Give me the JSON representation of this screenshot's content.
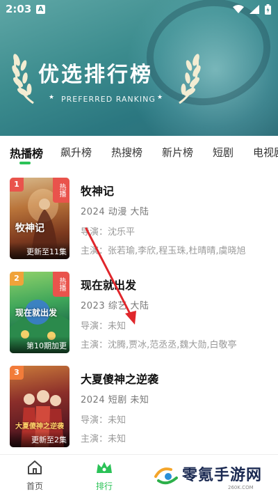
{
  "status": {
    "time": "2:03",
    "notif_icon": "A"
  },
  "banner": {
    "title": "优选排行榜",
    "subtitle": "PREFERRED RANKING"
  },
  "tabs": [
    {
      "label": "热播榜",
      "active": true
    },
    {
      "label": "飙升榜"
    },
    {
      "label": "热搜榜"
    },
    {
      "label": "新片榜"
    },
    {
      "label": "短剧"
    },
    {
      "label": "电视剧"
    }
  ],
  "items": [
    {
      "rank": "1",
      "hot_tag": "热播",
      "caption": "更新至11集",
      "art_text": "牧神记",
      "name": "牧神记",
      "meta": "2024  动漫  大陆",
      "director": "导演：沈乐平",
      "cast": "主演：张若瑜,李欣,程玉珠,杜晴晴,虞晓旭"
    },
    {
      "rank": "2",
      "hot_tag": "热播",
      "caption": "第10期加更",
      "art_text": "现在就出发",
      "name": "现在就出发",
      "meta": "2023  综艺  大陆",
      "director": "导演：未知",
      "cast": "主演：沈腾,贾冰,范丞丞,魏大勋,白敬亭"
    },
    {
      "rank": "3",
      "caption": "更新至2集",
      "art_text": "大夏傻神之逆袭",
      "name": "大夏傻神之逆袭",
      "meta": "2024  短剧  未知",
      "director": "导演：未知",
      "cast": "主演：未知"
    }
  ],
  "bottom_nav": [
    {
      "label": "首页",
      "icon": "home-icon"
    },
    {
      "label": "排行",
      "icon": "crown-icon",
      "active": true
    }
  ],
  "watermark": {
    "text": "零氪手游网",
    "sub": "260K.COM"
  },
  "colors": {
    "accent": "#2bc257",
    "rank1": "#e9534c",
    "rank2": "#f0a33a",
    "rank3": "#f27c3a",
    "banner": "#3c8c8e"
  }
}
